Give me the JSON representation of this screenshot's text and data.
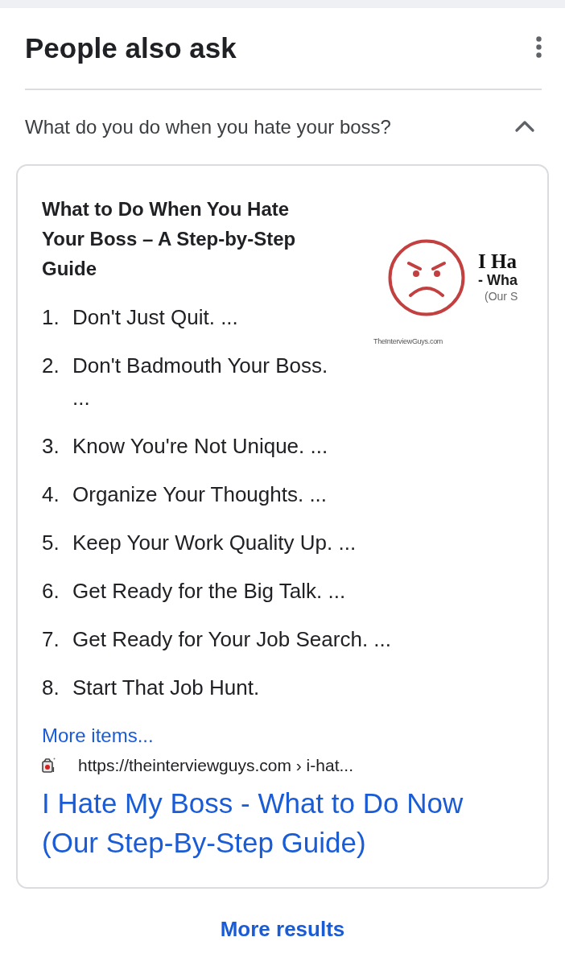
{
  "header": {
    "title": "People also ask"
  },
  "question": {
    "text": "What do you do when you hate your boss?",
    "expanded": true
  },
  "answer": {
    "title": "What to Do When You Hate Your Boss – A Step-by-Step Guide",
    "thumbnail": {
      "lines": [
        "I Ha",
        "- Wha",
        "(Our S"
      ],
      "caption": "TheInterviewGuys.com"
    },
    "items": [
      {
        "number": "1.",
        "text": "Don't Just Quit. ..."
      },
      {
        "number": "2.",
        "text": "Don't Badmouth Your Boss. ..."
      },
      {
        "number": "3.",
        "text": "Know You're Not Unique. ..."
      },
      {
        "number": "4.",
        "text": "Organize Your Thoughts. ..."
      },
      {
        "number": "5.",
        "text": "Keep Your Work Quality Up. ..."
      },
      {
        "number": "6.",
        "text": "Get Ready for the Big Talk. ..."
      },
      {
        "number": "7.",
        "text": "Get Ready for Your Job Search. ..."
      },
      {
        "number": "8.",
        "text": "Start That Job Hunt."
      }
    ],
    "more_items": "More items...",
    "source": {
      "url": "https://theinterviewguys.com › i-hat...",
      "title": "I Hate My Boss - What to Do Now (Our Step-By-Step Guide)"
    }
  },
  "more_results": "More results"
}
